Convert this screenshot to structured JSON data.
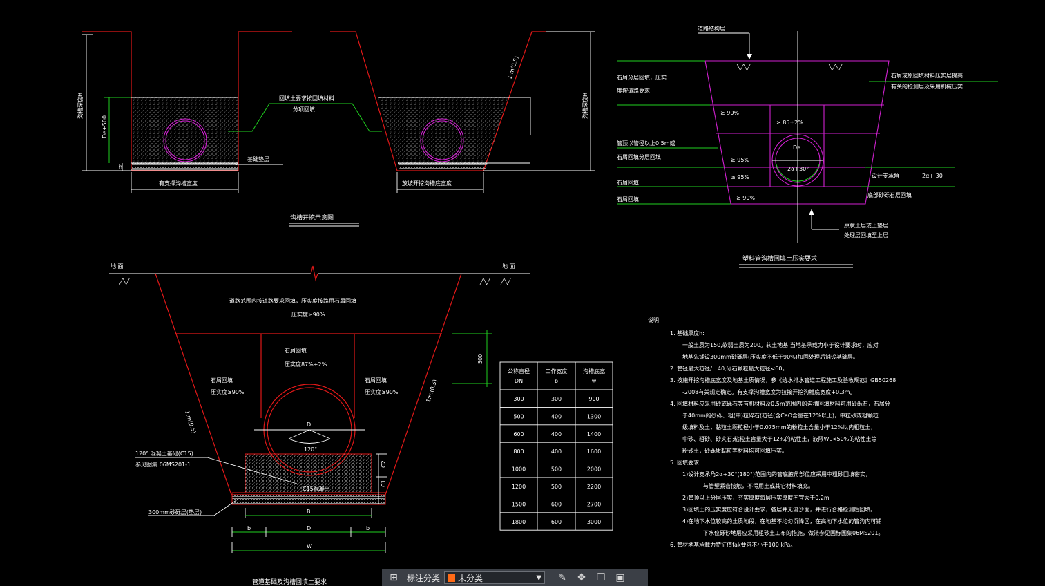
{
  "drawing": {
    "fig1": {
      "title": "沟槽开挖示意图",
      "depth_label_left": "沟槽深度H",
      "depth_label_right": "沟槽深度H",
      "de_label": "De+500",
      "h_label": "h",
      "backfill_note_1": "回填土要求按回填材料",
      "backfill_note_2": "分项回填",
      "base_label": "基础垫层",
      "width_left": "有支撑沟槽宽度",
      "width_right": "放坡开挖沟槽底宽度",
      "slope": "1:m(0.5)"
    },
    "fig2": {
      "title": "塑料管沟槽回填土压实要求",
      "road_label": "道路结构层",
      "left_1": "石屑分层回填，压实",
      "left_2": "度按道路要求",
      "left_3": "管顶以管径以上0.5m或",
      "left_4": "石屑回填分层回填",
      "left_5": "石屑回填",
      "left_6": "石屑回填",
      "right_1": "石屑或原回填材料压实层提高",
      "right_2": "有关的检测层及采用机械压实",
      "right_3": "设计支承角",
      "right_4": "2α+ 30",
      "right_5": "底部砂砾石层回填",
      "bottom_1": "原状土层或上垫层",
      "bottom_2": "处理层回填至上层",
      "p90a": "≥ 90%",
      "p85": "≥ 85±2%",
      "p95a": "≥ 95%",
      "p95b": "≥ 95%",
      "p90b": "≥ 90%",
      "de": "De",
      "angle": "2α+30°"
    },
    "fig3": {
      "title": "管道基础及沟槽回填土要求",
      "ground_left": "地 面",
      "ground_right": "地 面",
      "top_note_1": "道路范围内按道路要求回填，压实度按路用石屑回填",
      "top_note_2": "压实度≥90%",
      "mid_1": "石屑回填",
      "mid_2": "压实度87%+2%",
      "left_1": "石屑回填",
      "left_2": "压实度≥90%",
      "right_1": "石屑回填",
      "right_2": "压实度≥90%",
      "dim_500": "500",
      "slope_left": "1:m(0.5)",
      "slope_right": "1:m(0.5)",
      "d": "D",
      "angle": "120°",
      "base_1": "120° 混凝土基础(C15)",
      "base_2": "参见图集:06MS201-1",
      "c15": "C15混凝土",
      "sand": "300mm砂砾层(垫层)",
      "c1": "C1",
      "c2": "C2",
      "B": "B",
      "b1": "b",
      "D2": "D",
      "b2": "b",
      "W": "W"
    },
    "table": {
      "headers": [
        [
          "公称直径",
          "DN"
        ],
        [
          "工作宽度",
          "b"
        ],
        [
          "沟槽底宽",
          "w"
        ]
      ],
      "rows": [
        [
          "300",
          "300",
          "900"
        ],
        [
          "500",
          "400",
          "1300"
        ],
        [
          "600",
          "400",
          "1400"
        ],
        [
          "800",
          "400",
          "1600"
        ],
        [
          "1000",
          "500",
          "2000"
        ],
        [
          "1200",
          "500",
          "2200"
        ],
        [
          "1500",
          "600",
          "2700"
        ],
        [
          "1800",
          "600",
          "3000"
        ]
      ]
    },
    "notes": {
      "heading": "说明",
      "lines": [
        "1.   基础厚度h:",
        "一般土质为150,软弱土质为200。软土地基:当地基承载力小于设计要求时，应对",
        "地基先铺设300mm砂砾层(压实度不低于90%)加固处理后铺设基础层。",
        "2.   管径最大粒径∕…40,砾石颗粒最大粒径<60。",
        "3.   按施开挖沟槽底宽度及地基土质情况，参《给水排水管道工程施工及验收规范》GB50268",
        "-2008有关规定确定。有支撑沟槽宽度为拉接开挖沟槽底宽度+0.3m。",
        "4.   回填材料应采用砂或砾石等有机材料及0.5m范围内的沟槽回填材料可用砂砾石，石屑分",
        "于40mm的砂砾、粗(中)粒碎石(粒径(含CaO含量在12%以上)，中粒砂或粗颗粒",
        "级填料及土，黏粒土颗粒径小于0.075mm的粉粒土含量小于12%以内粗粒土，",
        "中砂、粗砂、砂夹石;粘粒土含量大于12%的粘性土，液限WL<50%的粘性土等",
        "粉砂土，砂砾质黏粒等材料均可回填压实。",
        "5.   回填要求",
        "1)设计支承角2α+30°(180°)范围内的管底腋角部位应采用中粗砂回填密实，",
        "与管壁紧密接触，不得用土或其它材料填充。",
        "2)管顶以上分层压实，夯实厚度每层压实厚度不宜大于0.2m",
        "3)回填土的压实度应符合设计要求，各层并无流沙面，并进行合格检测后回填。",
        "4)在地下水位较高的土质地段，在地基不均匀沉降区，在高地下水位的管沟内可铺",
        "下水位砾砂地层应采用粗砂土工布的措施，做法参见国标图集06MS201。",
        "6.   管材地基承载力特征值fak要求不小于100 kPa。"
      ]
    }
  },
  "toolbar": {
    "label": "标注分类",
    "select_value": "未分类",
    "select_color": "#ff6a16"
  }
}
